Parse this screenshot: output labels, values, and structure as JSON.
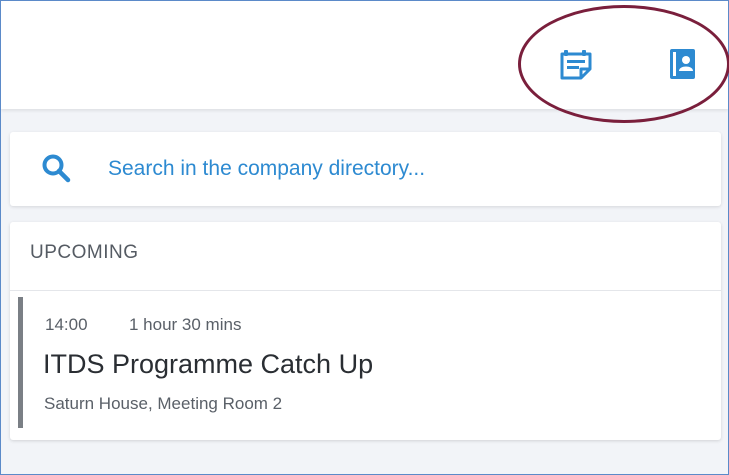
{
  "header": {
    "icons": [
      {
        "name": "calendar-notes-icon",
        "color": "#2d8ad1"
      },
      {
        "name": "contact-book-icon",
        "color": "#2d8ad1"
      }
    ]
  },
  "search": {
    "placeholder": "Search in the company directory...",
    "icon": "search-icon",
    "accent_color": "#2d8ad1"
  },
  "upcoming": {
    "header": "UPCOMING",
    "events": [
      {
        "time": "14:00",
        "duration": "1 hour 30 mins",
        "title": "ITDS Programme Catch Up",
        "location": "Saturn House, Meeting Room 2"
      }
    ]
  },
  "annotation": {
    "color": "#7a1f3c"
  }
}
